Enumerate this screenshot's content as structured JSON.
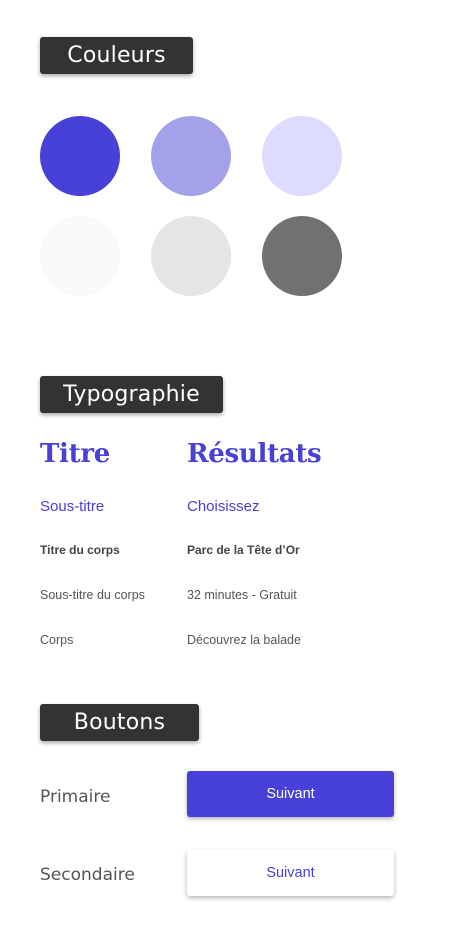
{
  "colors_section": {
    "title": "Couleurs",
    "swatches": [
      {
        "name": "primary",
        "color": "#4741d7"
      },
      {
        "name": "primary-medium",
        "color": "#a4a1ea"
      },
      {
        "name": "primary-light",
        "color": "#dedcfe"
      },
      {
        "name": "gray-lightest",
        "color": "#f9f9f9"
      },
      {
        "name": "gray-light",
        "color": "#e5e5e5"
      },
      {
        "name": "gray-dark",
        "color": "#717171"
      }
    ]
  },
  "typography_section": {
    "title": "Typographie",
    "column_labels": {
      "title": "Titre",
      "subtitle": "Sous-titre",
      "body_title": "Titre du corps",
      "body_subtitle": "Sous-titre du corps",
      "body": "Corps"
    },
    "column_examples": {
      "title": "Résultats",
      "subtitle": "Choisissez",
      "body_title": "Parc de la Tête d’Or",
      "body_subtitle": "32 minutes - Gratuit",
      "body": "Découvrez la balade"
    }
  },
  "buttons_section": {
    "title": "Boutons",
    "primary_label": "Primaire",
    "primary_button": "Suivant",
    "secondary_label": "Secondaire",
    "secondary_button": "Suivant"
  }
}
